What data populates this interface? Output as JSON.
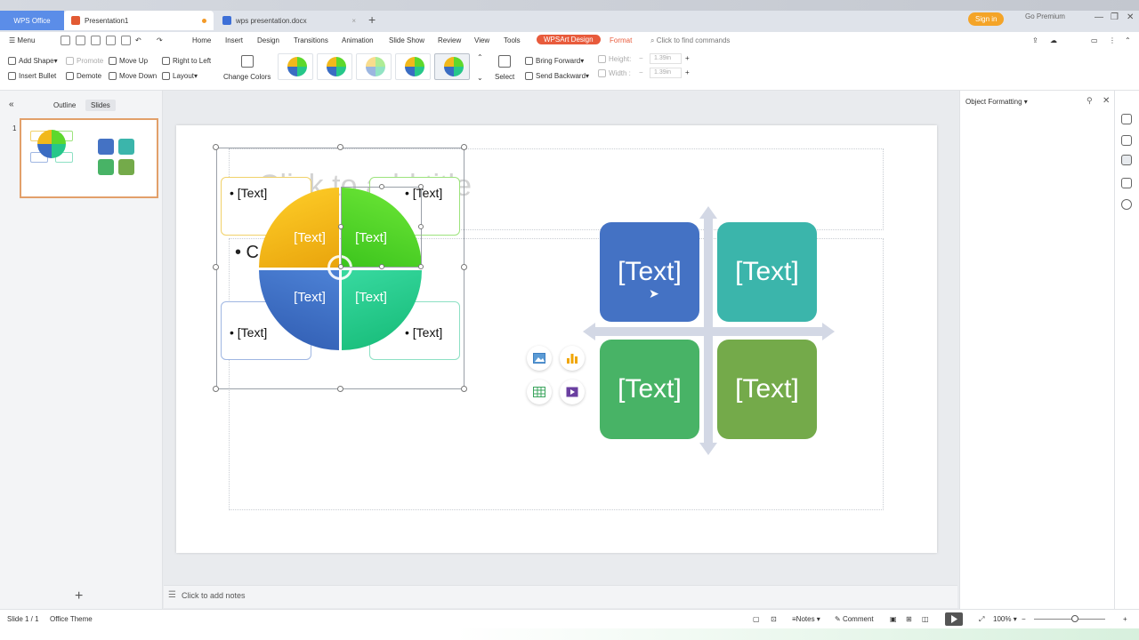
{
  "titlebar": {
    "app_tab": "WPS Office",
    "doc_tab": "Presentation1",
    "doc2_tab": "wps presentation.docx",
    "sign_in": "Sign in",
    "premium": "Go Premium"
  },
  "menubar": {
    "menu": "Menu",
    "tabs": [
      "Home",
      "Insert",
      "Design",
      "Transitions",
      "Animation",
      "Slide Show",
      "Review",
      "View",
      "Tools"
    ],
    "wpsart": "WPSArt Design",
    "format": "Format",
    "search_placeholder": "Click to find commands"
  },
  "ribbon": {
    "add_shape": "Add Shape",
    "promote": "Promote",
    "move_up": "Move Up",
    "right_to_left": "Right to Left",
    "insert_bullet": "Insert Bullet",
    "demote": "Demote",
    "move_down": "Move Down",
    "layout": "Layout",
    "change_colors": "Change Colors",
    "select": "Select",
    "bring_forward": "Bring Forward",
    "send_backward": "Send Backward",
    "height_label": "Height:",
    "width_label": "Width :",
    "height_value": "1.39in",
    "width_value": "1.39in"
  },
  "left_panel": {
    "outline_tab": "Outline",
    "slides_tab": "Slides",
    "slide_number": "1"
  },
  "slide": {
    "title_placeholder": "Click to add title",
    "body_bullet": "• C",
    "left_smartart": {
      "frame_texts": [
        "• [Text]",
        "• [Text]",
        "• [Text]",
        "• [Text]"
      ],
      "quad_texts": [
        "[Text]",
        "[Text]",
        "[Text]",
        "[Text]"
      ],
      "colors": {
        "yellow": "#f1b81b",
        "green": "#5dd82c",
        "blue": "#3a6cc2",
        "teal": "#26c78a"
      }
    },
    "right_matrix": {
      "box_texts": [
        "[Text]",
        "[Text]",
        "[Text]",
        "[Text]"
      ],
      "colors": {
        "blue": "#4472c4",
        "teal": "#3bb5ab",
        "green": "#48b366",
        "olive": "#74aa4a"
      }
    },
    "insert_icons": [
      "picture-icon",
      "chart-icon",
      "table-icon",
      "video-icon"
    ]
  },
  "notes": {
    "placeholder": "Click to add notes"
  },
  "right_panel": {
    "title": "Object Formatting"
  },
  "statusbar": {
    "slide_info": "Slide 1 / 1",
    "theme": "Office Theme",
    "notes": "Notes",
    "comment": "Comment",
    "zoom": "100%"
  }
}
